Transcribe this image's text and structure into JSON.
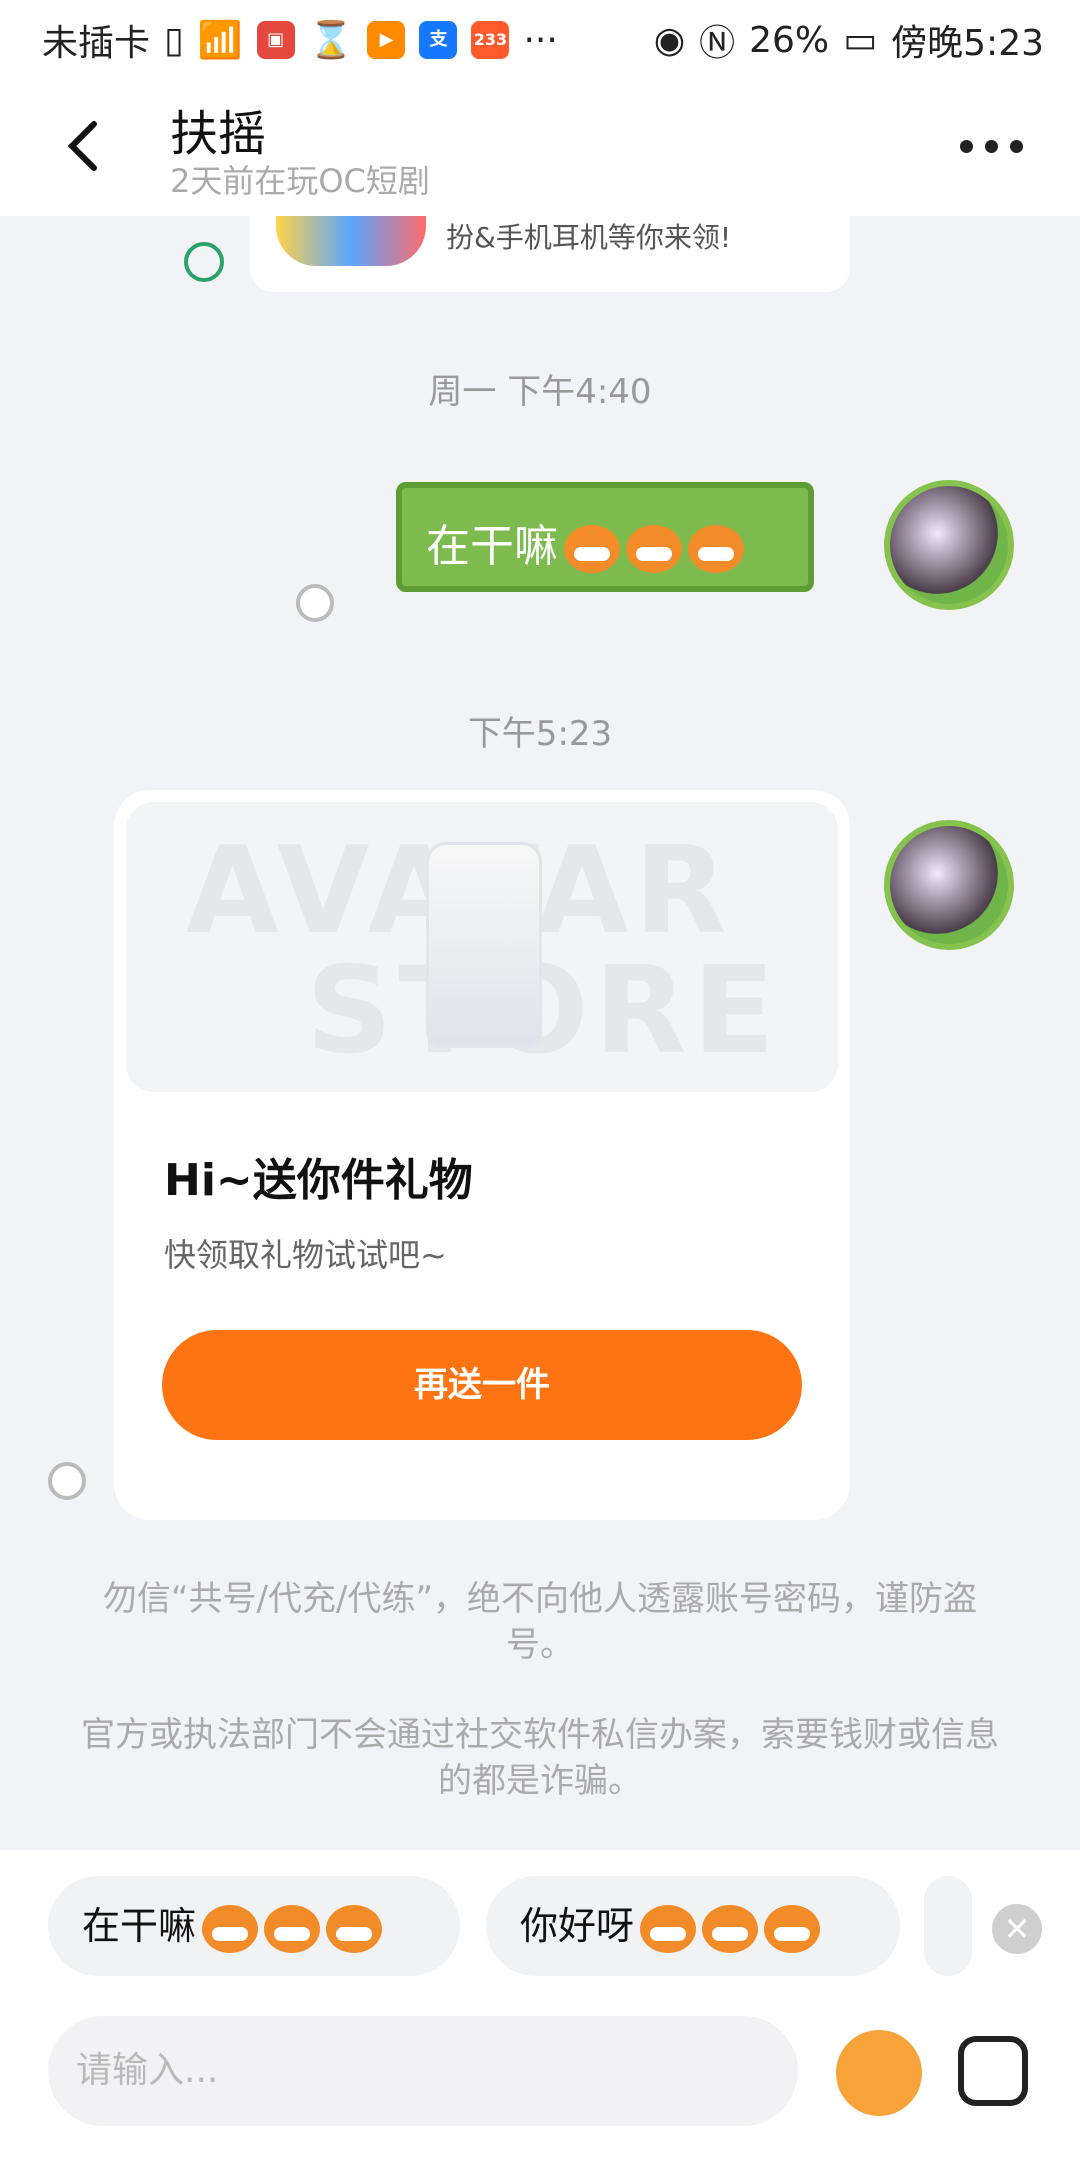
{
  "status_bar": {
    "carrier": "未插卡",
    "battery": "26%",
    "time": "傍晚5:23",
    "app_badge": "233",
    "more": "···"
  },
  "header": {
    "back_icon": "chevron-left-icon",
    "title": "扶摇",
    "subtitle": "2天前在玩OC短剧",
    "more_icon": "more-horizontal-icon"
  },
  "messages": {
    "system_card_text": "扮&手机耳机等你来领!",
    "time1": "周一 下午4:40",
    "bubble_text": "在干嘛",
    "time2": "下午5:23",
    "gift": {
      "watermark1": "AVATAR",
      "watermark2": "STORE",
      "title": "Hi~送你件礼物",
      "subtitle": "快领取礼物试试吧~",
      "button": "再送一件"
    }
  },
  "warnings": [
    "勿信“共号/代充/代练”，绝不向他人透露账号密码，谨防盗号。",
    "官方或执法部门不会通过社交软件私信办案，索要钱财或信息的都是诈骗。"
  ],
  "quick_replies": [
    {
      "text": "在干嘛"
    },
    {
      "text": "你好呀"
    }
  ],
  "input": {
    "placeholder": "请输入..."
  },
  "colors": {
    "accent": "#ff7412",
    "bubble": "#7dbb4e"
  }
}
